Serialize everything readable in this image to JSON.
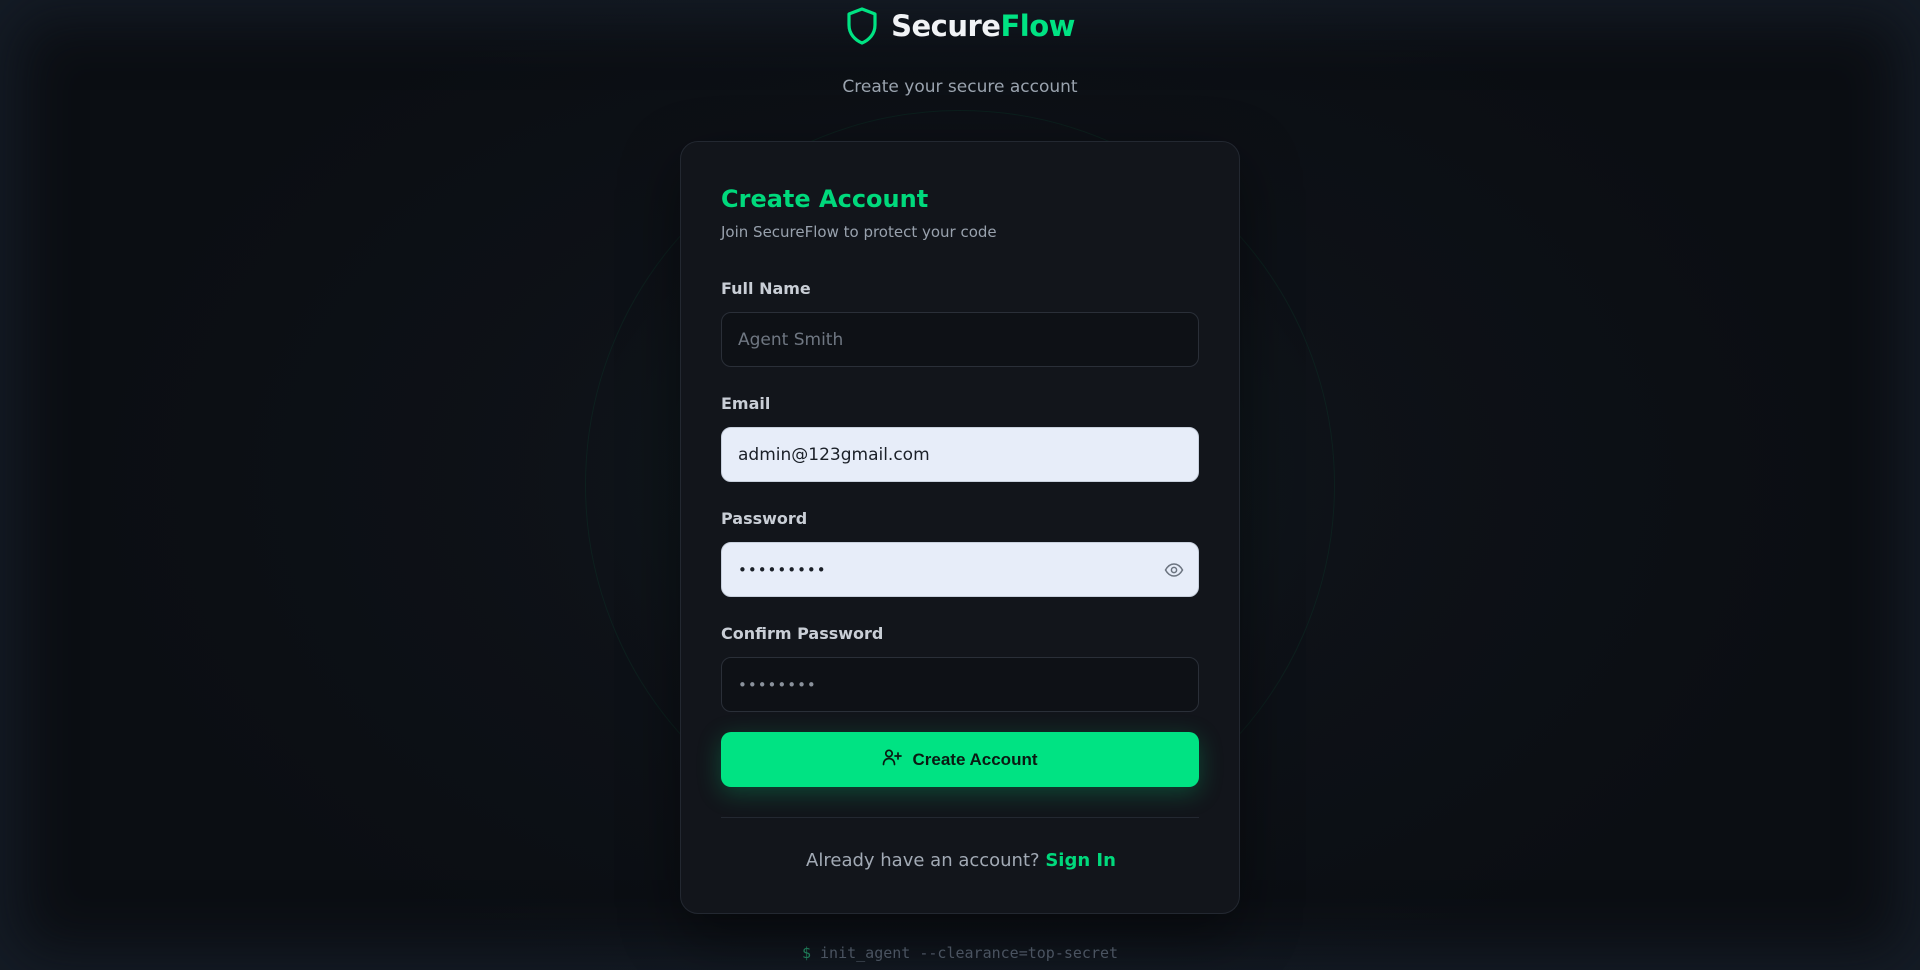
{
  "brand": {
    "name_part1": "Secure",
    "name_part2": "Flow",
    "icon": "shield-icon",
    "accent_color": "#00e383"
  },
  "tagline": "Create your secure account",
  "card": {
    "title": "Create Account",
    "subtitle": "Join SecureFlow to protect your code"
  },
  "form": {
    "full_name": {
      "label": "Full Name",
      "placeholder": "Agent Smith",
      "value": ""
    },
    "email": {
      "label": "Email",
      "value": "admin@123gmail.com"
    },
    "password": {
      "label": "Password",
      "value_masked": "•••••••••",
      "toggle_icon": "eye-icon"
    },
    "confirm_password": {
      "label": "Confirm Password",
      "value_masked": "••••••••"
    },
    "submit_label": "Create Account",
    "submit_icon": "user-plus-icon"
  },
  "footer": {
    "prompt_text": "Already have an account?",
    "link_label": "Sign In"
  },
  "terminal": {
    "prompt": "$",
    "command": "init_agent --clearance=top-secret"
  }
}
